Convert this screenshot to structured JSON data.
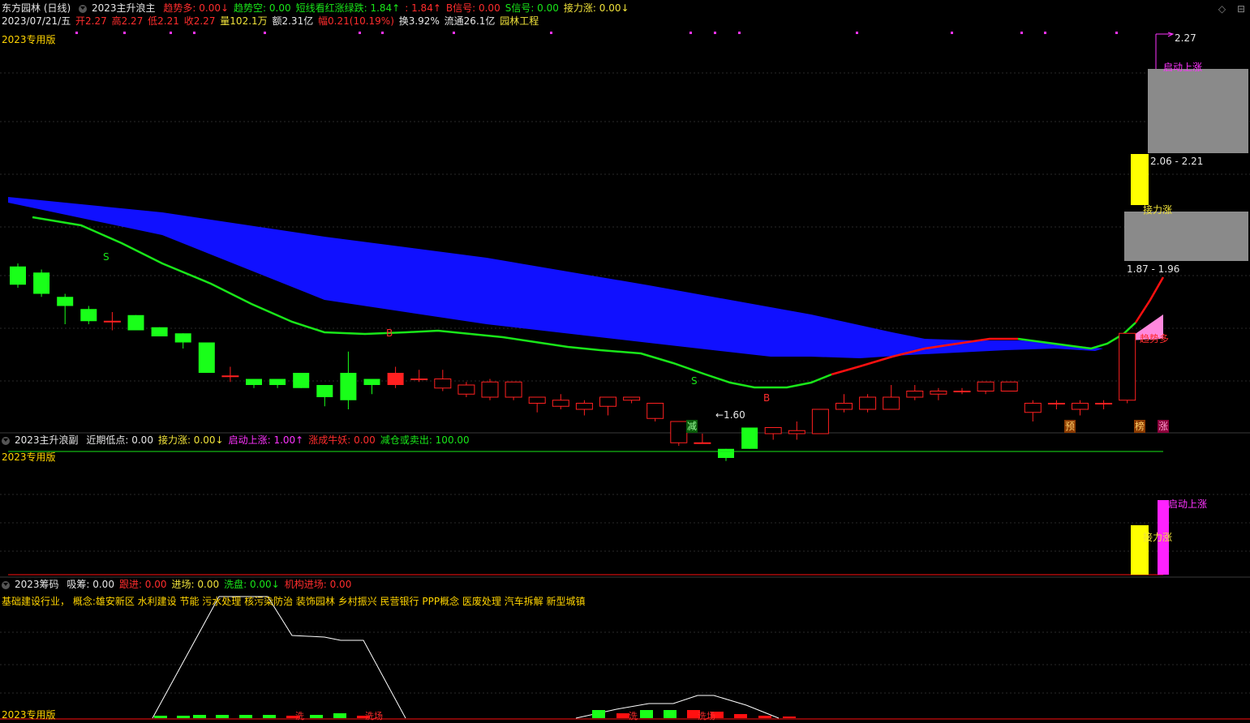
{
  "header": {
    "stock": "东方园林 (日线)",
    "indicator": "2023主升浪主",
    "items": [
      {
        "label": "趋势多: 0.00",
        "color": "r",
        "arrow": "↓"
      },
      {
        "label": "趋势空: 0.00",
        "color": "g",
        "arrow": ""
      },
      {
        "label": "短线看红涨绿跌: 1.84",
        "color": "g",
        "arrow": "↑"
      },
      {
        "label": ": 1.84",
        "color": "r",
        "arrow": "↑"
      },
      {
        "label": "B信号: 0.00",
        "color": "r",
        "arrow": ""
      },
      {
        "label": "S信号: 0.00",
        "color": "g",
        "arrow": ""
      },
      {
        "label": "接力涨: 0.00",
        "color": "y",
        "arrow": "↓"
      }
    ],
    "icons": [
      "diamond-icon",
      "maximize-icon"
    ]
  },
  "quote": {
    "date": "2023/07/21/五",
    "open": "开2.27",
    "high": "高2.27",
    "low": "低2.21",
    "close": "收2.27",
    "volume": "量102.1万",
    "amount": "额2.31亿",
    "change": "幅0.21(10.19%)",
    "turnover": "换3.92%",
    "float": "流通26.1亿",
    "industry": "园林工程"
  },
  "main_panel": {
    "edition": "2023专用版",
    "annotations": {
      "top_price": "2.27",
      "qidong": "启动上涨",
      "range1": "2.06 - 2.21",
      "jieli": "接力涨",
      "range2": "1.87 - 1.96",
      "trend": "趋势多",
      "low_price": "←1.60",
      "s1": "S",
      "s2": "S",
      "b1": "B",
      "b2": "B",
      "jian": "减",
      "yu": "预",
      "bang": "榜",
      "zhang": "涨"
    }
  },
  "sub_panel": {
    "title": "2023主升浪副",
    "items": [
      {
        "label": "近期低点: 0.00",
        "color": "w",
        "arrow": ""
      },
      {
        "label": "接力涨: 0.00",
        "color": "y",
        "arrow": "↓"
      },
      {
        "label": "启动上涨: 1.00",
        "color": "m",
        "arrow": "↑"
      },
      {
        "label": "涨成牛妖: 0.00",
        "color": "r",
        "arrow": ""
      },
      {
        "label": "减仓或卖出: 100.00",
        "color": "g",
        "arrow": ""
      }
    ],
    "edition": "2023专用版",
    "label_qidong": "启动上涨",
    "label_jieli": "接力涨"
  },
  "chip_panel": {
    "title": "2023筹码",
    "items": [
      {
        "label": "吸筹: 0.00",
        "color": "w",
        "arrow": ""
      },
      {
        "label": "跟进: 0.00",
        "color": "r",
        "arrow": ""
      },
      {
        "label": "进场: 0.00",
        "color": "y",
        "arrow": ""
      },
      {
        "label": "洗盘: 0.00",
        "color": "g",
        "arrow": "↓"
      },
      {
        "label": "机构进场: 0.00",
        "color": "r",
        "arrow": ""
      }
    ],
    "concepts": "基础建设行业， 概念:雄安新区 水利建设 节能 污水处理 核污染防治 装饰园林 乡村振兴 民营银行 PPP概念 医废处理 汽车拆解 新型城镇",
    "edition": "2023专用版",
    "marks": [
      "洗",
      "洗场",
      "洗",
      "洗场"
    ]
  },
  "colors": {
    "up": "#ff2020",
    "down": "#19ff19",
    "ribbon": "#1010ff",
    "ma_green": "#19e619",
    "ma_red": "#ff1010",
    "pink": "#ff88dd",
    "gray_box": "#8a8a8a",
    "yellow": "#ffff00",
    "magenta": "#ff22ff"
  },
  "chart_data": {
    "type": "candlestick",
    "title": "东方园林 (日线)",
    "ylim": [
      1.55,
      2.32
    ],
    "candles": [
      {
        "o": 1.95,
        "c": 1.89,
        "h": 1.96,
        "l": 1.88
      },
      {
        "o": 1.93,
        "c": 1.86,
        "h": 1.94,
        "l": 1.85
      },
      {
        "o": 1.85,
        "c": 1.82,
        "h": 1.86,
        "l": 1.76
      },
      {
        "o": 1.81,
        "c": 1.77,
        "h": 1.82,
        "l": 1.76
      },
      {
        "o": 1.77,
        "c": 1.77,
        "h": 1.8,
        "l": 1.74
      },
      {
        "o": 1.79,
        "c": 1.74,
        "h": 1.79,
        "l": 1.74
      },
      {
        "o": 1.75,
        "c": 1.72,
        "h": 1.75,
        "l": 1.72
      },
      {
        "o": 1.73,
        "c": 1.7,
        "h": 1.73,
        "l": 1.68
      },
      {
        "o": 1.7,
        "c": 1.6,
        "h": 1.7,
        "l": 1.6
      },
      {
        "o": 1.59,
        "c": 1.59,
        "h": 1.62,
        "l": 1.57
      },
      {
        "o": 1.58,
        "c": 1.56,
        "h": 1.58,
        "l": 1.55
      },
      {
        "o": 1.58,
        "c": 1.56,
        "h": 1.58,
        "l": 1.55
      },
      {
        "o": 1.6,
        "c": 1.55,
        "h": 1.6,
        "l": 1.55
      },
      {
        "o": 1.56,
        "c": 1.52,
        "h": 1.56,
        "l": 1.49
      },
      {
        "o": 1.6,
        "c": 1.51,
        "h": 1.67,
        "l": 1.48
      },
      {
        "o": 1.58,
        "c": 1.56,
        "h": 1.58,
        "l": 1.53
      },
      {
        "o": 1.56,
        "c": 1.6,
        "h": 1.62,
        "l": 1.55
      },
      {
        "o": 1.58,
        "c": 1.58,
        "h": 1.61,
        "l": 1.57
      },
      {
        "o": 1.55,
        "c": 1.58,
        "h": 1.61,
        "l": 1.54
      },
      {
        "o": 1.53,
        "c": 1.56,
        "h": 1.57,
        "l": 1.52
      },
      {
        "o": 1.52,
        "c": 1.57,
        "h": 1.58,
        "l": 1.51
      },
      {
        "o": 1.52,
        "c": 1.57,
        "h": 1.57,
        "l": 1.51
      },
      {
        "o": 1.5,
        "c": 1.52,
        "h": 1.52,
        "l": 1.47
      },
      {
        "o": 1.49,
        "c": 1.51,
        "h": 1.53,
        "l": 1.48
      },
      {
        "o": 1.48,
        "c": 1.5,
        "h": 1.51,
        "l": 1.46
      },
      {
        "o": 1.49,
        "c": 1.52,
        "h": 1.52,
        "l": 1.46
      },
      {
        "o": 1.51,
        "c": 1.52,
        "h": 1.52,
        "l": 1.5
      },
      {
        "o": 1.45,
        "c": 1.5,
        "h": 1.5,
        "l": 1.44
      },
      {
        "o": 1.37,
        "c": 1.44,
        "h": 1.44,
        "l": 1.36
      },
      {
        "o": 1.37,
        "c": 1.37,
        "h": 1.4,
        "l": 1.37
      },
      {
        "o": 1.35,
        "c": 1.32,
        "h": 1.35,
        "l": 1.31
      },
      {
        "o": 1.42,
        "c": 1.35,
        "h": 1.42,
        "l": 1.35
      },
      {
        "o": 1.4,
        "c": 1.42,
        "h": 1.42,
        "l": 1.38
      },
      {
        "o": 1.4,
        "c": 1.41,
        "h": 1.44,
        "l": 1.38
      },
      {
        "o": 1.4,
        "c": 1.48,
        "h": 1.48,
        "l": 1.4
      },
      {
        "o": 1.48,
        "c": 1.5,
        "h": 1.53,
        "l": 1.47
      },
      {
        "o": 1.48,
        "c": 1.52,
        "h": 1.53,
        "l": 1.47
      },
      {
        "o": 1.48,
        "c": 1.52,
        "h": 1.56,
        "l": 1.48
      },
      {
        "o": 1.52,
        "c": 1.54,
        "h": 1.56,
        "l": 1.51
      },
      {
        "o": 1.53,
        "c": 1.54,
        "h": 1.55,
        "l": 1.51
      },
      {
        "o": 1.54,
        "c": 1.54,
        "h": 1.55,
        "l": 1.53
      },
      {
        "o": 1.54,
        "c": 1.57,
        "h": 1.57,
        "l": 1.53
      },
      {
        "o": 1.54,
        "c": 1.57,
        "h": 1.57,
        "l": 1.54
      },
      {
        "o": 1.47,
        "c": 1.5,
        "h": 1.51,
        "l": 1.44
      },
      {
        "o": 1.5,
        "c": 1.5,
        "h": 1.51,
        "l": 1.48
      },
      {
        "o": 1.48,
        "c": 1.5,
        "h": 1.51,
        "l": 1.46
      },
      {
        "o": 1.5,
        "c": 1.5,
        "h": 1.51,
        "l": 1.48
      },
      {
        "o": 1.51,
        "c": 1.73,
        "h": 1.73,
        "l": 1.5
      }
    ]
  }
}
